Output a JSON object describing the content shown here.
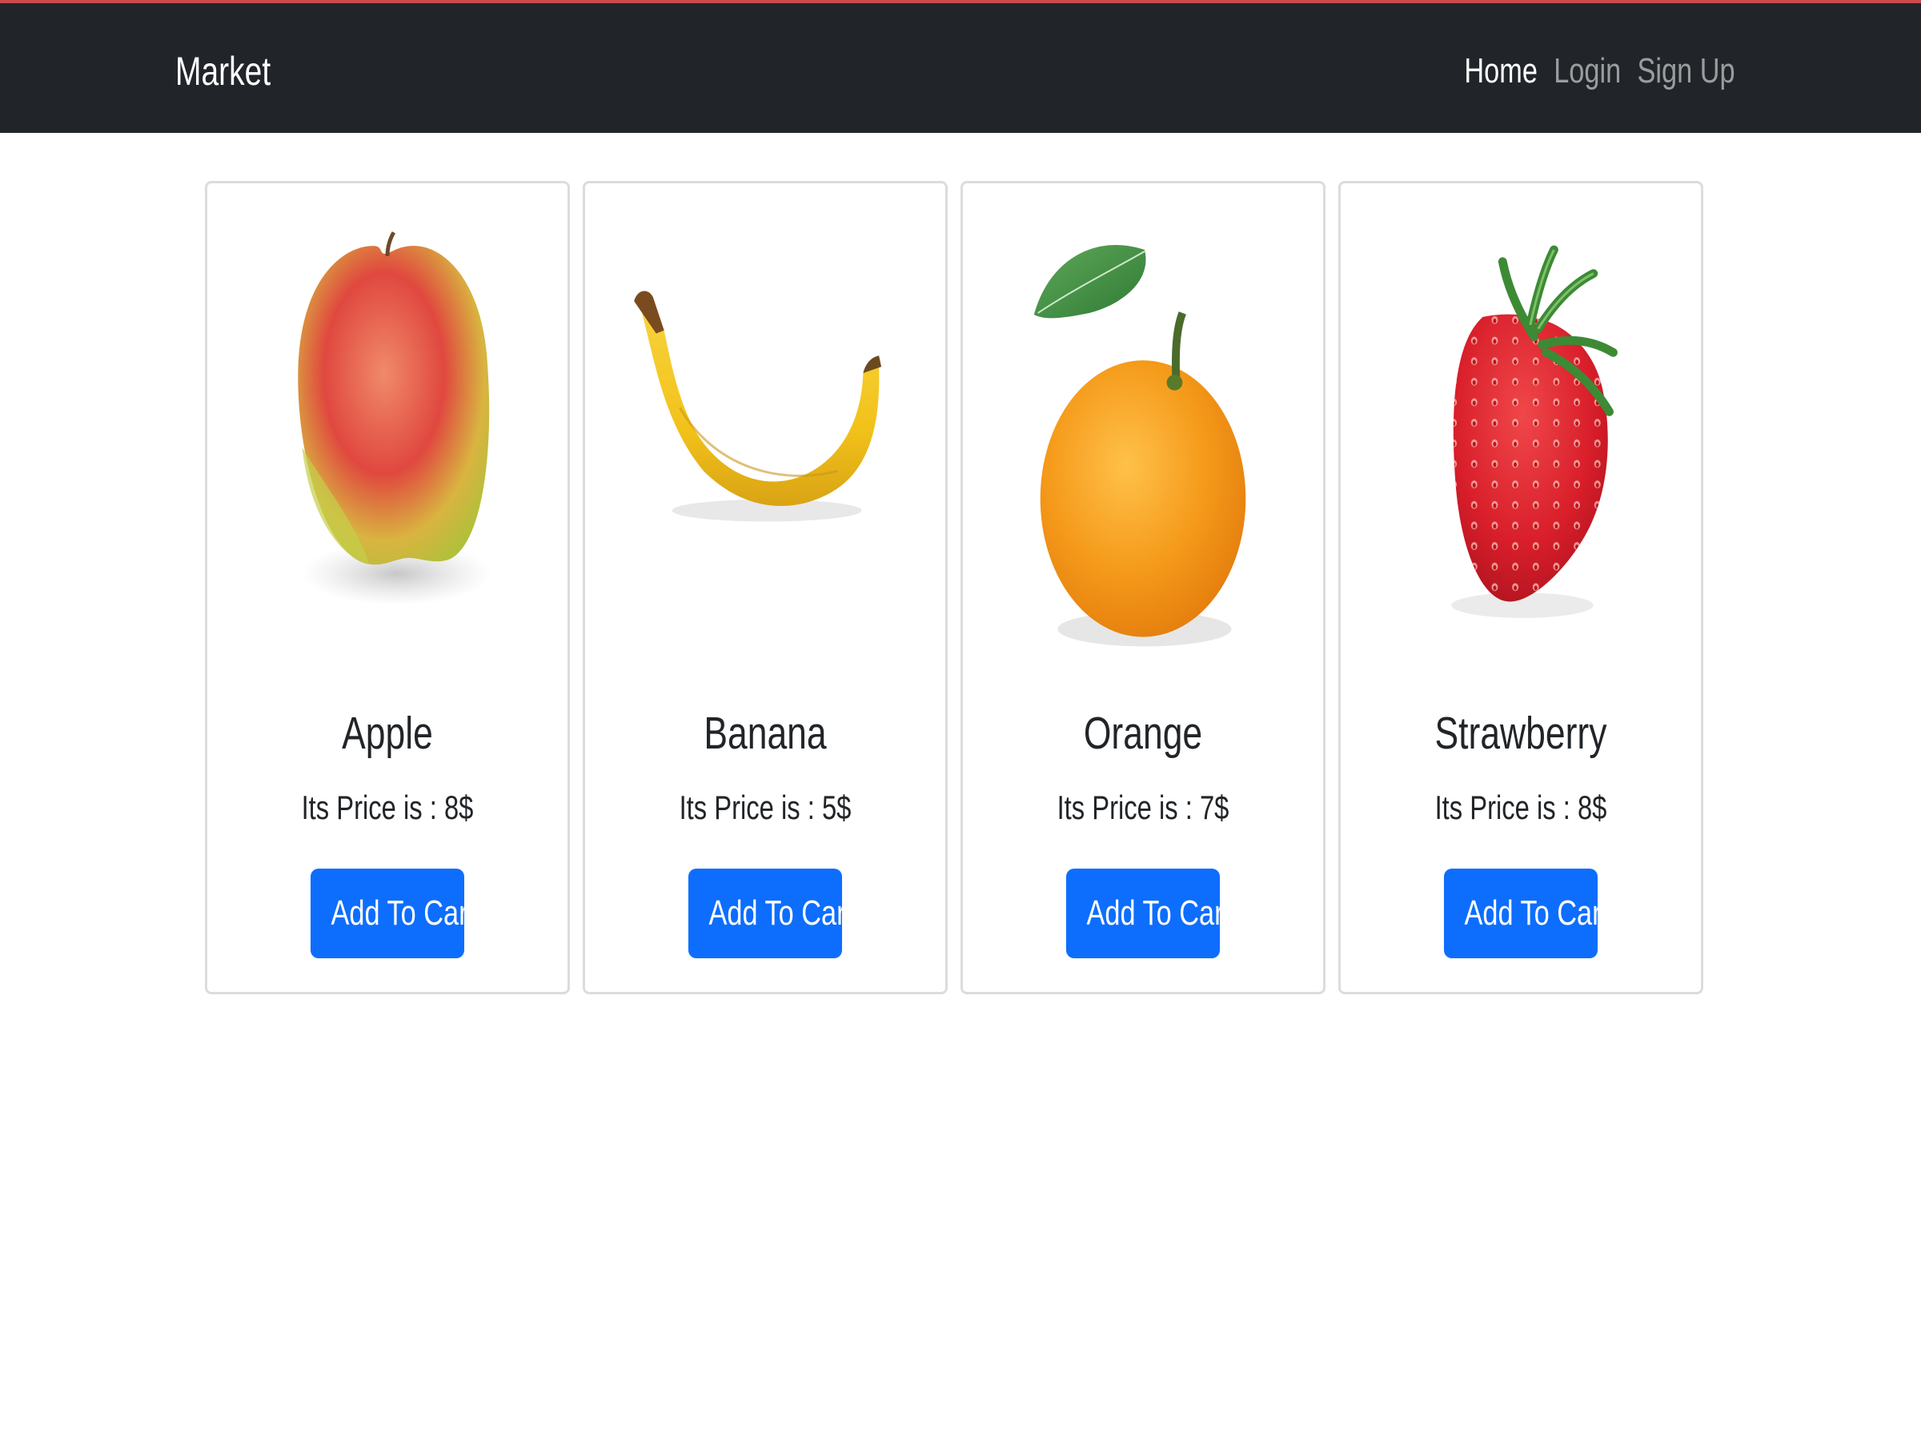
{
  "navbar": {
    "brand": "Market",
    "links": [
      {
        "label": "Home",
        "active": true
      },
      {
        "label": "Login",
        "active": false
      },
      {
        "label": "Sign Up",
        "active": false
      }
    ]
  },
  "products": [
    {
      "name": "Apple",
      "price_text": "Its Price is : 8$",
      "button": "Add To Cart",
      "image": "apple-image"
    },
    {
      "name": "Banana",
      "price_text": "Its Price is : 5$",
      "button": "Add To Cart",
      "image": "banana-image"
    },
    {
      "name": "Orange",
      "price_text": "Its Price is : 7$",
      "button": "Add To Cart",
      "image": "orange-image"
    },
    {
      "name": "Strawberry",
      "price_text": "Its Price is : 8$",
      "button": "Add To Cart",
      "image": "strawberry-image"
    }
  ],
  "colors": {
    "navbar_bg": "#212529",
    "top_accent": "#c94a4a",
    "button_bg": "#0d6efd",
    "card_border": "#dcdcdc"
  }
}
